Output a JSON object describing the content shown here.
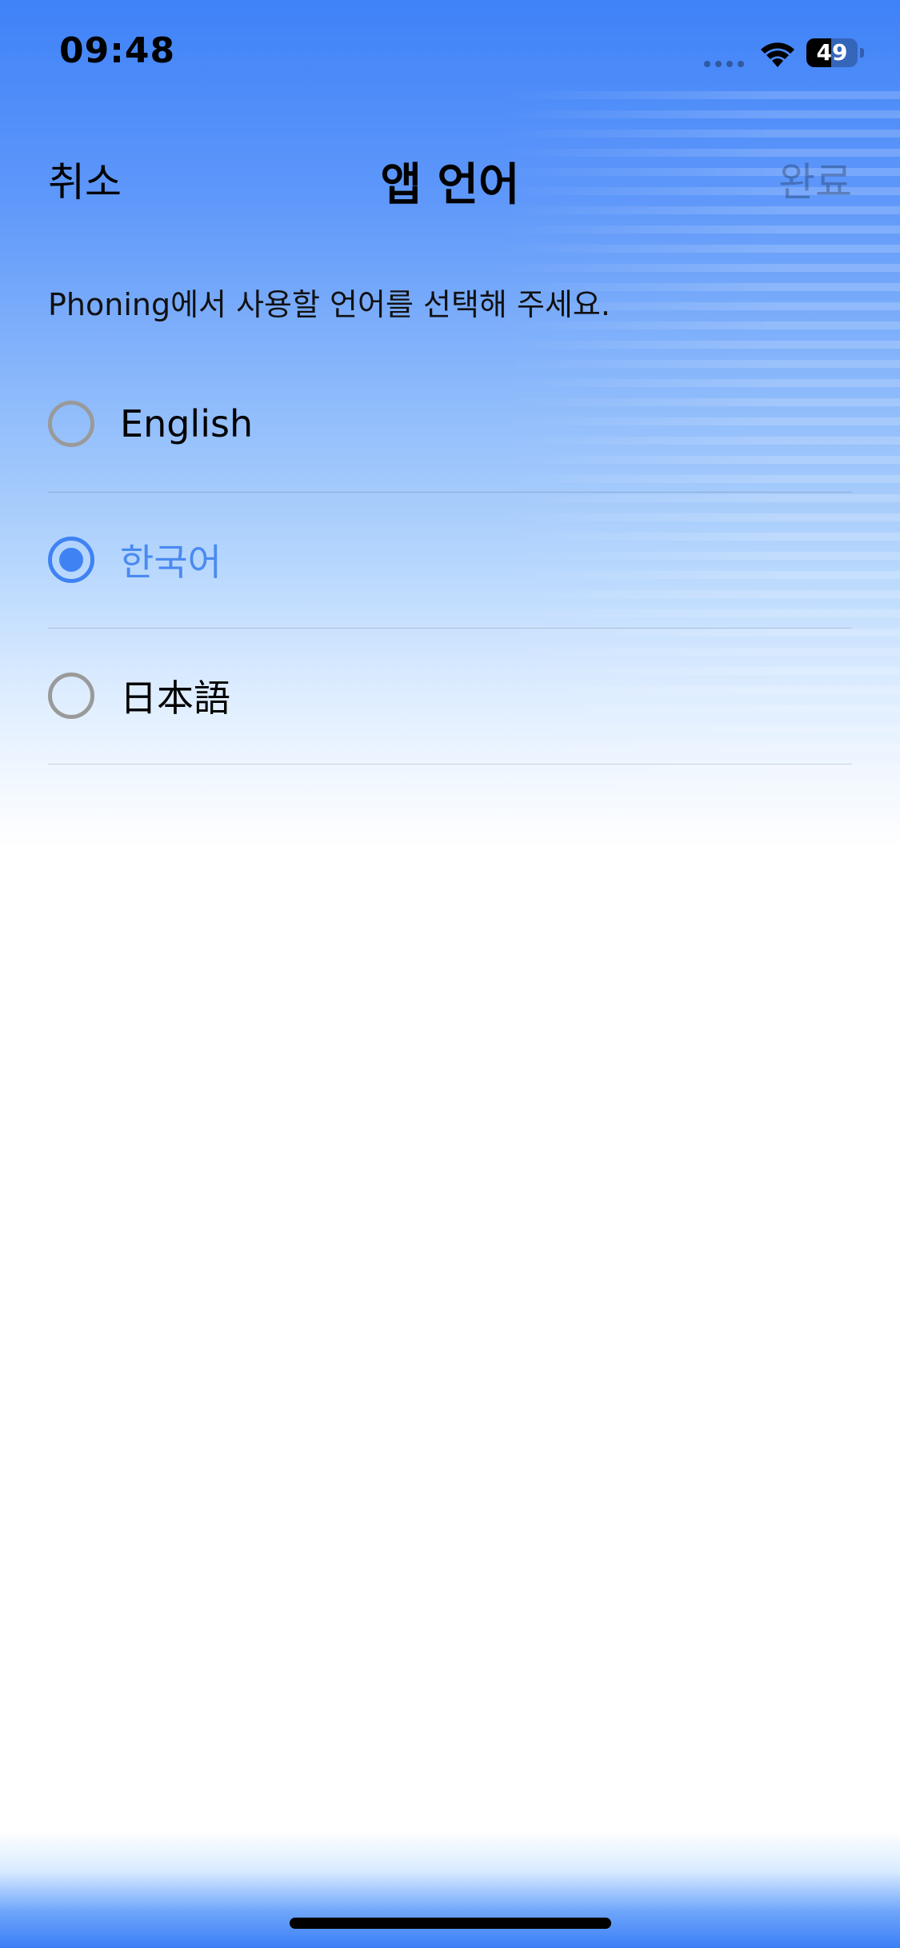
{
  "status_bar": {
    "time": "09:48",
    "battery_level": "49",
    "battery_fraction": 0.49
  },
  "nav": {
    "cancel_label": "취소",
    "title": "앱 언어",
    "done_label": "완료"
  },
  "description": "Phoning에서 사용할 언어를 선택해 주세요.",
  "languages": [
    {
      "label": "English",
      "selected": false
    },
    {
      "label": "한국어",
      "selected": true
    },
    {
      "label": "日本語",
      "selected": false
    }
  ],
  "colors": {
    "accent": "#3f82f3",
    "radio_unselected": "#9a9a9a",
    "done_disabled": "rgba(0,0,0,0.25)"
  },
  "icons": [
    "signal-icon",
    "wifi-icon",
    "battery-icon"
  ]
}
